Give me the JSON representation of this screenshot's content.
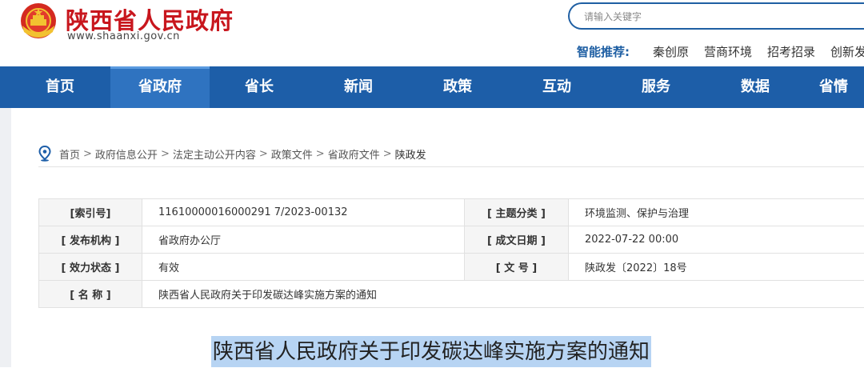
{
  "header": {
    "site_title": "陕西省人民政府",
    "site_url": "www.shaanxi.gov.cn",
    "search_placeholder": "请输入关键字",
    "recommend_label": "智能推荐:",
    "recommend_links": [
      "秦创原",
      "营商环境",
      "招考招录",
      "创新发"
    ],
    "emblem_icon": "national-emblem-icon"
  },
  "nav": {
    "items": [
      "首页",
      "省政府",
      "省长",
      "新闻",
      "政策",
      "互动",
      "服务",
      "数据",
      "省情"
    ],
    "active_index": 1
  },
  "breadcrumb": {
    "items": [
      "首页",
      "政府信息公开",
      "法定主动公开内容",
      "政策文件",
      "省政府文件",
      "陕政发"
    ],
    "separator": ">"
  },
  "info": {
    "index_no_label": "[索引号]",
    "index_no": "11610000016000291 7/2023-00132",
    "topic_label": "[ 主题分类 ]",
    "topic": "环境监测、保护与治理",
    "issuer_label": "[ 发布机构 ]",
    "issuer": "省政府办公厅",
    "date_label": "[ 成文日期 ]",
    "date": "2022-07-22 00:00",
    "status_label": "[ 效力状态 ]",
    "status": "有效",
    "docno_label": "[ 文 号 ]",
    "docno": "陕政发〔2022〕18号",
    "name_label": "[ 名 称 ]",
    "name": "陕西省人民政府关于印发碳达峰实施方案的通知"
  },
  "document": {
    "title": "陕西省人民政府关于印发碳达峰实施方案的通知"
  },
  "colors": {
    "brand_red": "#c8161d",
    "nav_blue": "#1d5ea8",
    "nav_active": "#2f73c0",
    "highlight": "#b7d4f3"
  }
}
